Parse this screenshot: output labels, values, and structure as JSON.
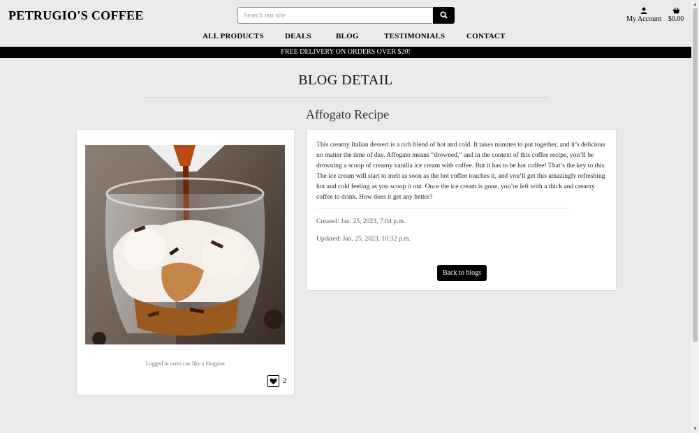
{
  "header": {
    "brand": "PETRUGIO'S COFFEE",
    "search": {
      "placeholder": "Search our site",
      "value": ""
    },
    "account_label": "My Account",
    "basket_total": "$0.00"
  },
  "nav": {
    "items": [
      "ALL PRODUCTS",
      "DEALS",
      "BLOG",
      "TESTIMONIALS",
      "CONTACT"
    ]
  },
  "promo": "FREE DELIVERY ON ORDERS OVER $20!",
  "page": {
    "title": "BLOG DETAIL"
  },
  "post": {
    "title": "Affogato Recipe",
    "body": "This creamy Italian dessert is a rich blend of hot and cold. It takes minutes to put together, and it’s delicious no matter the time of day. Affogato means “drowned,” and in the context of this coffee recipe, you’ll be drowning a scoop of creamy vanilla ice cream with coffee. But it has to be hot coffee! That’s the key to this. The ice cream will start to melt as soon as the hot coffee touches it, and you’ll get this amazingly refreshing hot and cold feeling as you scoop it out. Once the ice cream is gone, you’re left with a thick and creamy coffee to drink. How does it get any better?",
    "created": "Created: Jan. 25, 2023, 7:04 p.m.",
    "updated": "Updated: Jan. 25, 2023, 10:32 p.m.",
    "back_label": "Back to blogs",
    "like_note": "Logged in users can like a blogpost",
    "like_count": "2"
  },
  "colors": {
    "background": "#e9eaec",
    "accent": "#000000",
    "card": "#ffffff"
  }
}
